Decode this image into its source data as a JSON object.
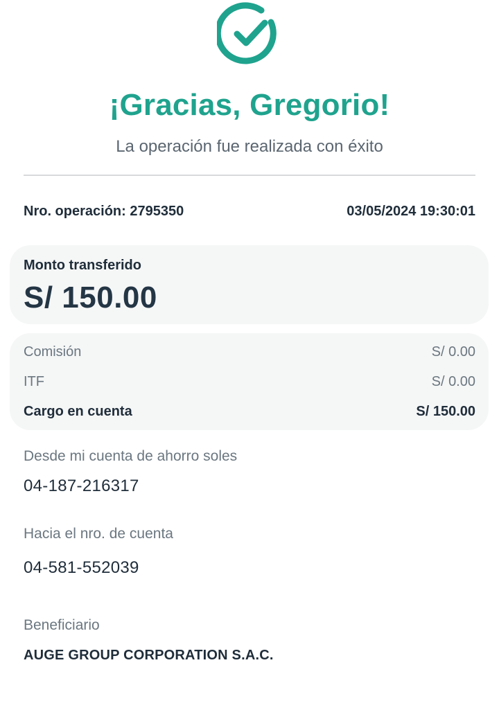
{
  "header": {
    "icon": "check-circle-icon",
    "title": "¡Gracias, Gregorio!",
    "subtitle": "La operación fue realizada con éxito"
  },
  "operation": {
    "number_label": "Nro. operación: 2795350",
    "datetime": "03/05/2024 19:30:01"
  },
  "amount": {
    "label": "Monto transferido",
    "value": "S/ 150.00"
  },
  "charges": [
    {
      "label": "Comisión",
      "value": "S/ 0.00"
    },
    {
      "label": "ITF",
      "value": "S/ 0.00"
    },
    {
      "label": "Cargo en cuenta",
      "value": "S/ 150.00"
    }
  ],
  "from_account": {
    "label": "Desde mi cuenta de ahorro soles",
    "value": "04-187-216317"
  },
  "to_account": {
    "label": "Hacia el nro. de cuenta",
    "value": "04-581-552039"
  },
  "beneficiary": {
    "label": "Beneficiario",
    "value": "AUGE GROUP CORPORATION S.A.C."
  },
  "colors": {
    "accent": "#1fa38e",
    "text_dark": "#1f2d3a",
    "text_muted": "#6b7780",
    "card_bg": "#f5f6f6"
  }
}
